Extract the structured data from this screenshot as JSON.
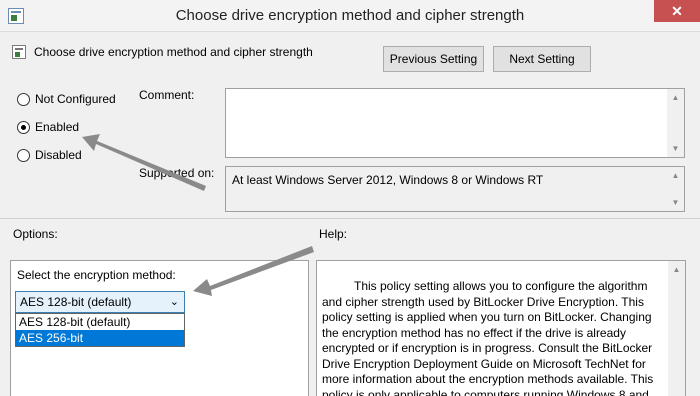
{
  "window": {
    "title": "Choose drive encryption method and cipher strength",
    "close_glyph": "✕"
  },
  "header": {
    "policy_name": "Choose drive encryption method and cipher strength",
    "previous_label": "Previous Setting",
    "next_label": "Next Setting"
  },
  "state": {
    "options": [
      {
        "label": "Not Configured",
        "selected": false
      },
      {
        "label": "Enabled",
        "selected": true
      },
      {
        "label": "Disabled",
        "selected": false
      }
    ]
  },
  "comment": {
    "label": "Comment:",
    "value": ""
  },
  "supported": {
    "label": "Supported on:",
    "value": "At least Windows Server 2012, Windows 8 or Windows RT"
  },
  "options_section": {
    "label": "Options:",
    "method_label": "Select the encryption method:",
    "selected_value": "AES 128-bit (default)",
    "dropdown_items": [
      {
        "label": "AES 128-bit (default)",
        "highlighted": false
      },
      {
        "label": "AES 256-bit",
        "highlighted": true
      }
    ]
  },
  "help_section": {
    "label": "Help:",
    "text": "This policy setting allows you to configure the algorithm and cipher strength used by BitLocker Drive Encryption. This policy setting is applied when you turn on BitLocker. Changing the encryption method has no effect if the drive is already encrypted or if encryption is in progress. Consult the BitLocker Drive Encryption Deployment Guide on Microsoft TechNet for more information about the encryption methods available. This policy is only applicable to computers running Windows 8 and"
  },
  "colors": {
    "close_button": "#c75050",
    "dropdown_highlight": "#0078d7",
    "arrow": "#8a8a8a"
  }
}
